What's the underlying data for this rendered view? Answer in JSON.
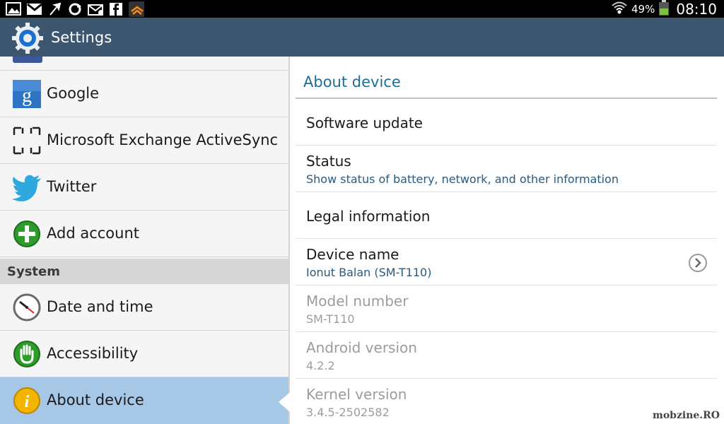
{
  "status_bar": {
    "battery_percent": "49%",
    "clock": "08:10"
  },
  "action_bar": {
    "title": "Settings"
  },
  "left_pane": {
    "items": [
      {
        "label": "Google",
        "icon": "google-icon"
      },
      {
        "label": "Microsoft Exchange ActiveSync",
        "icon": "exchange-icon"
      },
      {
        "label": "Twitter",
        "icon": "twitter-icon"
      },
      {
        "label": "Add account",
        "icon": "add-icon"
      }
    ],
    "section": "System",
    "system_items": [
      {
        "label": "Date and time",
        "icon": "clock-icon"
      },
      {
        "label": "Accessibility",
        "icon": "hand-icon"
      },
      {
        "label": "About device",
        "icon": "info-icon",
        "selected": true
      }
    ]
  },
  "right_pane": {
    "title": "About device",
    "items": [
      {
        "title": "Software update"
      },
      {
        "title": "Status",
        "summary": "Show status of battery, network, and other information"
      },
      {
        "title": "Legal information"
      },
      {
        "title": "Device name",
        "summary": "Ionut Balan (SM-T110)"
      },
      {
        "title": "Model number",
        "summary": "SM-T110"
      },
      {
        "title": "Android version",
        "summary": "4.2.2"
      },
      {
        "title": "Kernel version",
        "summary": "3.4.5-2502582"
      }
    ]
  },
  "watermark": "mobzine.RO",
  "colors": {
    "action_bar": "#3c566f",
    "selected_row": "#a7c7e6",
    "header_text": "#1f6c98"
  }
}
